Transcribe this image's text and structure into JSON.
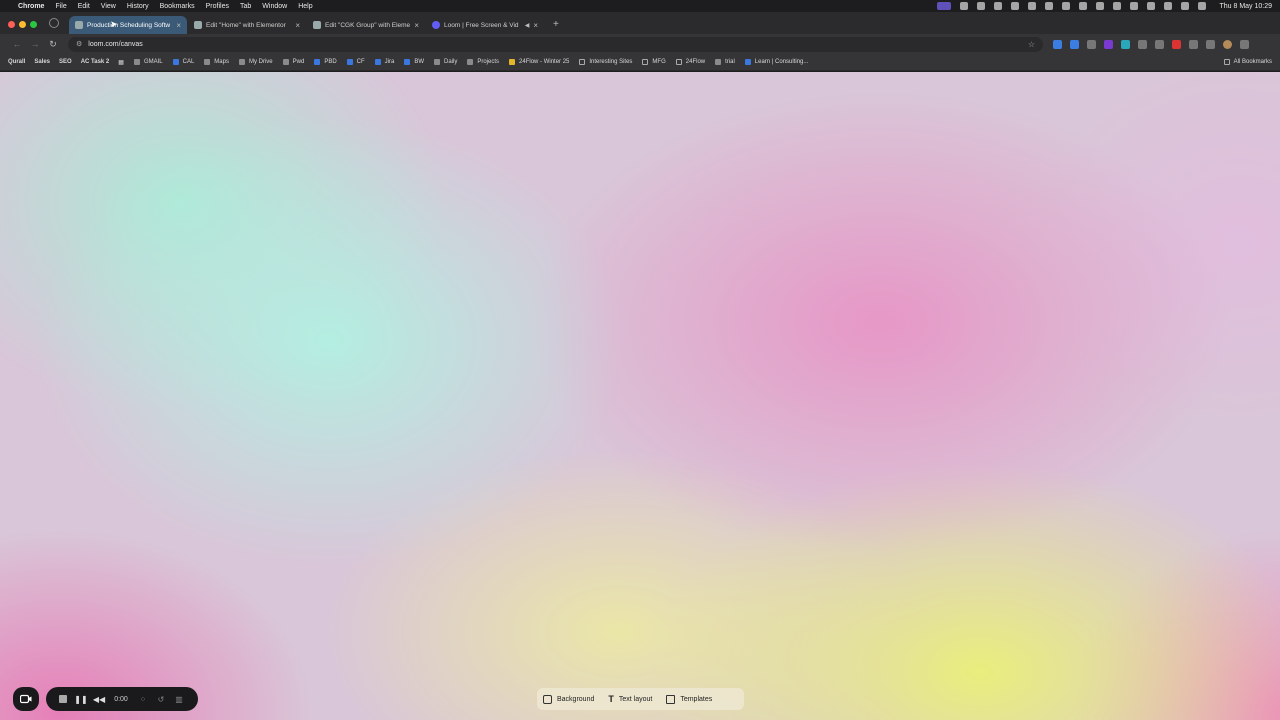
{
  "menubar": {
    "app": "Chrome",
    "items": [
      "File",
      "Edit",
      "View",
      "History",
      "Bookmarks",
      "Profiles",
      "Tab",
      "Window",
      "Help"
    ],
    "clock": "Thu 8 May  10:29"
  },
  "tabs": [
    {
      "title": "Production Scheduling Softw",
      "active": true
    },
    {
      "title": "Edit \"Home\" with Elementor",
      "active": false
    },
    {
      "title": "Edit \"CGK Group\" with Eleme",
      "active": false
    },
    {
      "title": "Loom | Free Screen & Vid",
      "active": false
    }
  ],
  "address": {
    "url": "loom.com/canvas"
  },
  "bookmarks": {
    "items": [
      "Qurall",
      "Sales",
      "SEO",
      "AC Task 2",
      "GMAIL",
      "CAL",
      "Maps",
      "My Drive",
      "Pwd",
      "PBD",
      "CF",
      "Jira",
      "BW",
      "Daily",
      "Projects",
      "24Flow - Winter 25",
      "Interesting Sites",
      "MFG",
      "24Flow",
      "trial",
      "Learn | Consulting..."
    ],
    "all": "All Bookmarks"
  },
  "recorder": {
    "timer": "0:00"
  },
  "canvas_tools": {
    "background": "Background",
    "text_layout": "Text layout",
    "templates": "Templates"
  },
  "colors": {
    "mint": "#b2f0e2",
    "pink": "#e892c4",
    "yellow": "#eaf078",
    "tab_active": "#3a5a78"
  }
}
